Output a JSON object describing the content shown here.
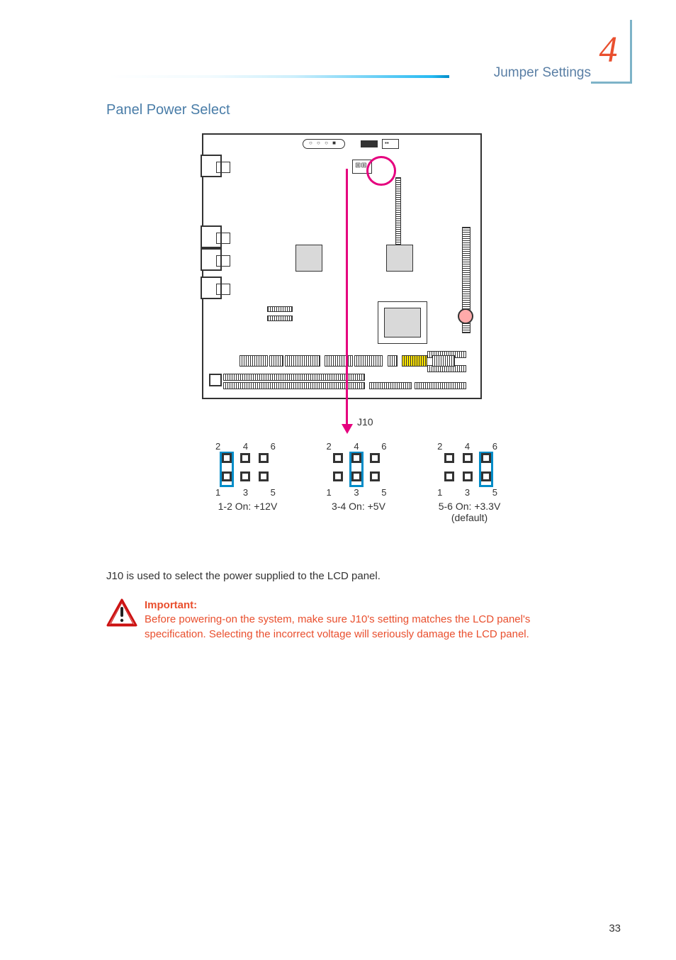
{
  "chapter_number": "4",
  "header_title": "Jumper Settings",
  "section_title": "Panel Power Select",
  "jumper_ref": "J10",
  "jumper_options": [
    {
      "pins_top": "2  4  6",
      "pins_bottom": "1  3  5",
      "setting": "1-2 On: +12V",
      "default": "",
      "shunt_col": 0
    },
    {
      "pins_top": "2  4  6",
      "pins_bottom": "1  3  5",
      "setting": "3-4 On: +5V",
      "default": "",
      "shunt_col": 1
    },
    {
      "pins_top": "2  4  6",
      "pins_bottom": "1  3  5",
      "setting": "5-6 On: +3.3V",
      "default": "(default)",
      "shunt_col": 2
    }
  ],
  "body_text": "J10 is used to select the power supplied to the LCD panel.",
  "warning": {
    "label": "Important:",
    "text": "Before powering-on the system, make sure J10's setting matches the LCD panel's specification. Selecting the incorrect voltage will seriously damage the LCD panel."
  },
  "page_number": "33"
}
